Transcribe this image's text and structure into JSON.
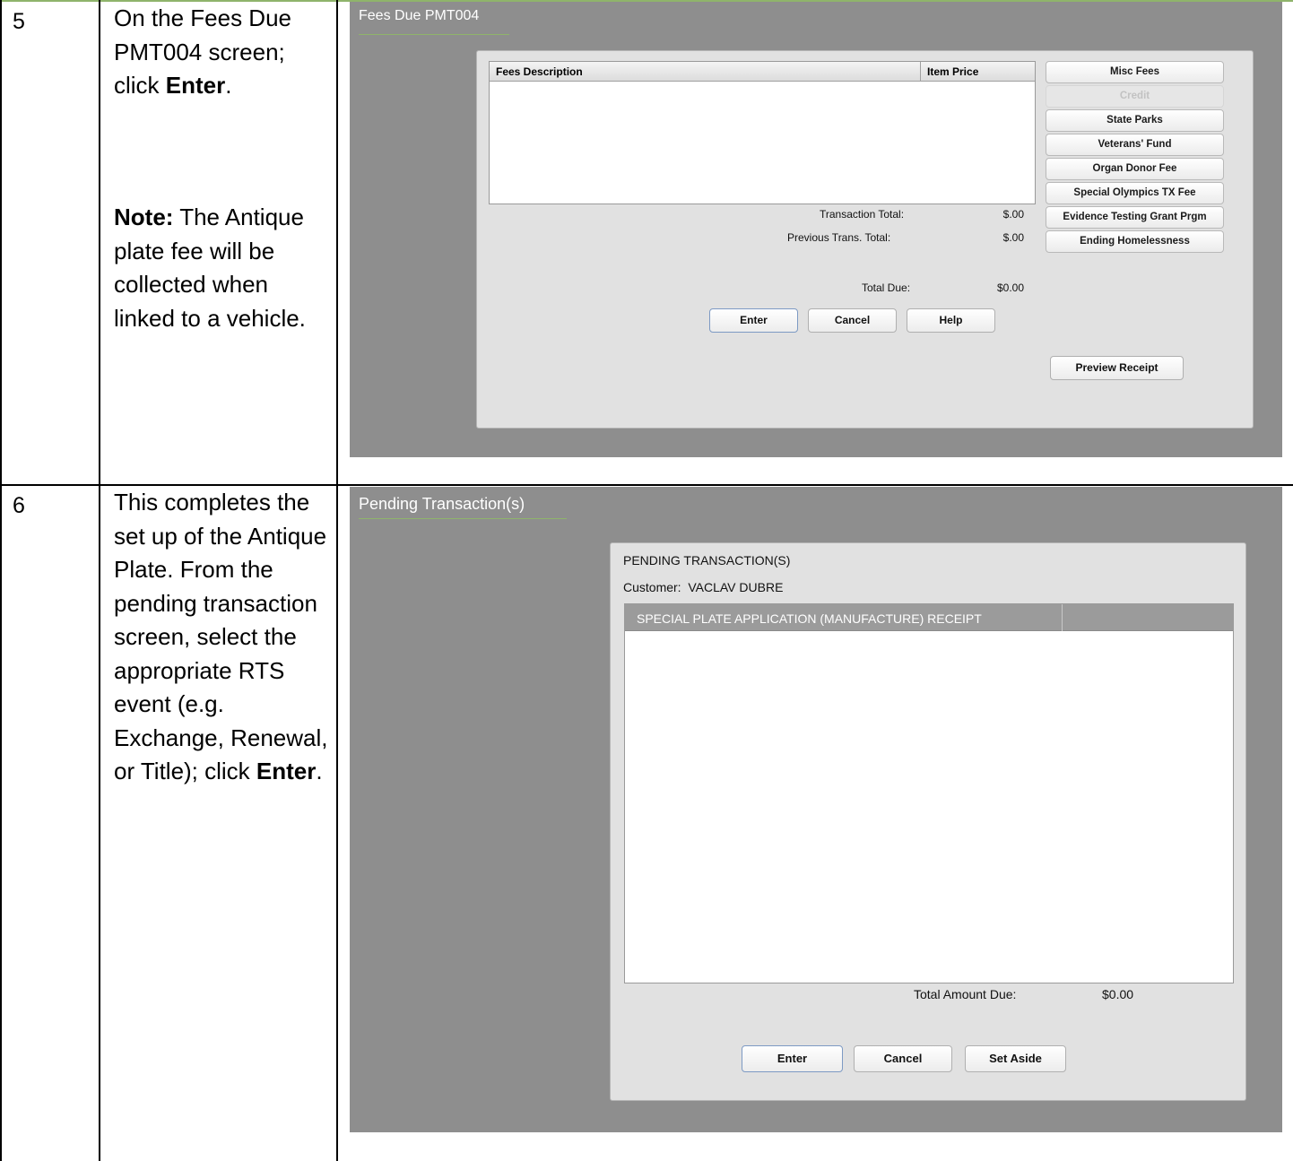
{
  "steps": [
    {
      "number": "5",
      "text_parts": [
        "On the Fees Due PMT004 screen; click ",
        "Enter",
        "."
      ],
      "note_label": "Note:",
      "note_text": " The Antique plate fee will be collected when linked to a vehicle."
    },
    {
      "number": "6",
      "text_parts": [
        "This completes the set up of the Antique Plate. From the pending transaction screen, select the appropriate RTS event (e.g. Exchange, Renewal, or Title); click ",
        "Enter",
        "."
      ]
    }
  ],
  "fees_screen": {
    "title": "Fees Due PMT004",
    "columns": [
      "Fees Description",
      "Item Price"
    ],
    "side_buttons": [
      {
        "label": "Misc Fees",
        "enabled": true
      },
      {
        "label": "Credit",
        "enabled": false
      },
      {
        "label": "State Parks",
        "enabled": true
      },
      {
        "label": "Veterans' Fund",
        "enabled": true
      },
      {
        "label": "Organ Donor Fee",
        "enabled": true
      },
      {
        "label": "Special Olympics TX Fee",
        "enabled": true
      },
      {
        "label": "Evidence Testing Grant Prgm",
        "enabled": true
      },
      {
        "label": "Ending Homelessness",
        "enabled": true
      }
    ],
    "transaction_total_label": "Transaction Total:",
    "transaction_total_value": "$.00",
    "previous_total_label": "Previous Trans. Total:",
    "previous_total_value": "$.00",
    "total_due_label": "Total Due:",
    "total_due_value": "$0.00",
    "buttons": {
      "enter": "Enter",
      "cancel": "Cancel",
      "help": "Help"
    },
    "preview_receipt": "Preview Receipt"
  },
  "pending_screen": {
    "title": "Pending Transaction(s)",
    "heading": "PENDING TRANSACTION(S)",
    "customer": "Customer:  VACLAV DUBRE",
    "row": "SPECIAL PLATE APPLICATION (MANUFACTURE) RECEIPT",
    "total_label": "Total Amount Due:",
    "total_value": "$0.00",
    "buttons": {
      "enter": "Enter",
      "cancel": "Cancel",
      "set_aside": "Set Aside"
    }
  },
  "colors": {
    "screen_background": "#8e8e8e",
    "dialog_background": "#e1e1e1",
    "title_underline": "#8fb46b",
    "row_highlight": "#9b9b9b"
  }
}
